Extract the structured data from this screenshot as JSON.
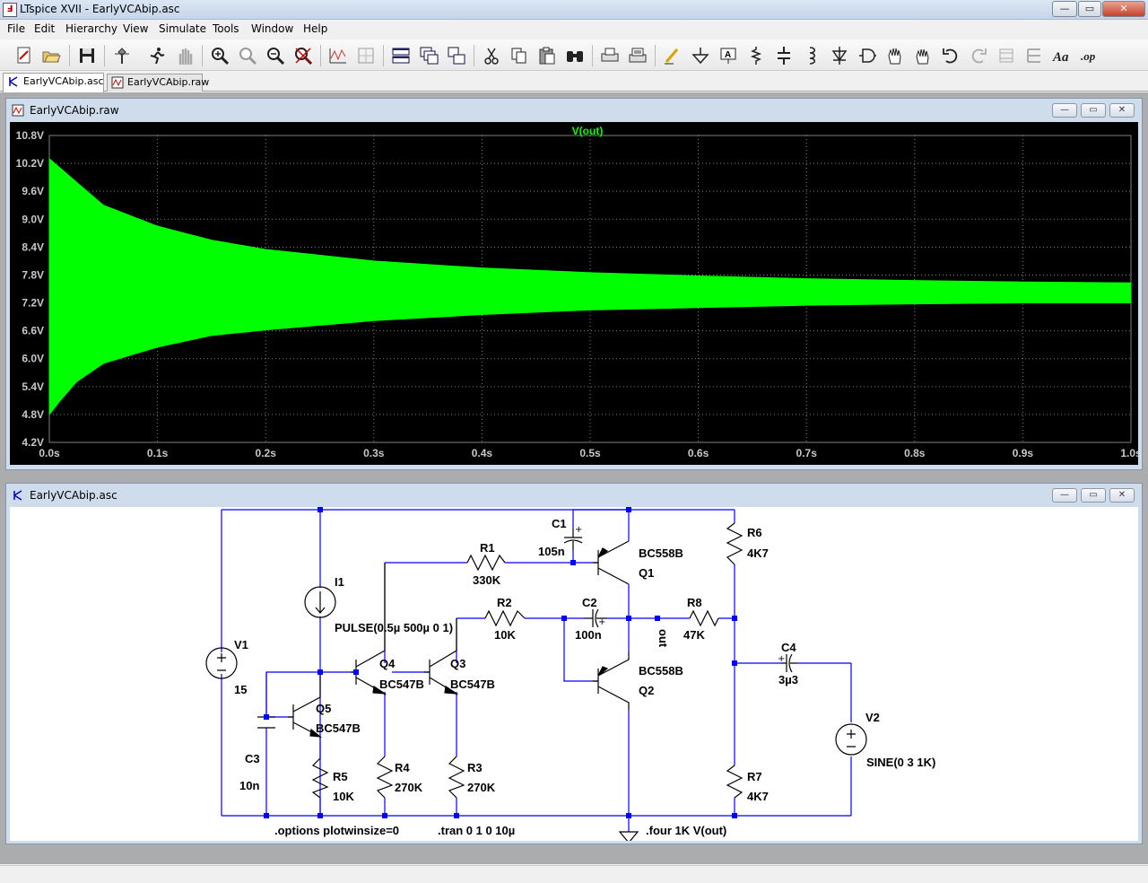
{
  "window": {
    "title": "LTspice XVII - EarlyVCAbip.asc",
    "app_icon": "ltspice-logo-icon",
    "controls": {
      "minimize": "—",
      "maximize": "▭",
      "close": "✕"
    }
  },
  "menu": {
    "items": [
      "File",
      "Edit",
      "Hierarchy",
      "View",
      "Simulate",
      "Tools",
      "Window",
      "Help"
    ]
  },
  "toolbar": {
    "buttons": [
      "new-schematic-icon",
      "open-icon",
      "save-icon",
      "control-panel-icon",
      "run-icon",
      "halt-icon",
      "zoom-in-icon",
      "zoom-fit-icon",
      "zoom-out-icon",
      "zoom-cancel-icon",
      "autorange-icon",
      "waveform-grid-icon",
      "tile-horizontal-icon",
      "cascade-icon",
      "tile-vertical-icon",
      "cut-icon",
      "copy-icon",
      "paste-icon",
      "find-icon",
      "print-icon",
      "print-setup-icon",
      "wire-icon",
      "ground-icon",
      "label-icon",
      "resistor-icon",
      "capacitor-icon",
      "inductor-icon",
      "diode-icon",
      "component-icon",
      "move-icon",
      "drag-icon",
      "undo-icon",
      "redo-icon",
      "rotate-icon",
      "mirror-icon",
      "text-icon",
      "spice-directive-icon"
    ]
  },
  "tabs": [
    {
      "label": "EarlyVCAbip.asc",
      "icon": "schematic-icon",
      "active": true
    },
    {
      "label": "EarlyVCAbip.raw",
      "icon": "waveform-icon",
      "active": false
    }
  ],
  "plot_window": {
    "title": "EarlyVCAbip.raw",
    "icon": "waveform-icon",
    "trace_color": "#00ff00",
    "background": "#000000",
    "chart_data": {
      "type": "area",
      "title": "V(out)",
      "xlabel": "",
      "ylabel": "",
      "x_ticks": [
        "0.0s",
        "0.1s",
        "0.2s",
        "0.3s",
        "0.4s",
        "0.5s",
        "0.6s",
        "0.7s",
        "0.8s",
        "0.9s",
        "1.0s"
      ],
      "y_ticks": [
        "10.8V",
        "10.2V",
        "9.6V",
        "9.0V",
        "8.4V",
        "7.8V",
        "7.2V",
        "6.6V",
        "6.0V",
        "5.4V",
        "4.8V",
        "4.2V"
      ],
      "xlim": [
        0,
        1.0
      ],
      "ylim": [
        4.2,
        10.8
      ],
      "grid": true,
      "series": [
        {
          "name": "V(out)",
          "x": [
            0.0,
            0.01,
            0.025,
            0.05,
            0.1,
            0.15,
            0.2,
            0.3,
            0.4,
            0.5,
            0.6,
            0.7,
            0.8,
            0.9,
            1.0
          ],
          "upper": [
            10.3,
            10.1,
            9.8,
            9.3,
            8.85,
            8.55,
            8.35,
            8.1,
            7.95,
            7.85,
            7.78,
            7.72,
            7.68,
            7.65,
            7.63
          ],
          "lower": [
            4.8,
            5.1,
            5.5,
            5.9,
            6.25,
            6.5,
            6.62,
            6.82,
            6.95,
            7.05,
            7.1,
            7.15,
            7.18,
            7.2,
            7.2
          ]
        }
      ]
    }
  },
  "schematic_window": {
    "title": "EarlyVCAbip.asc",
    "icon": "schematic-icon",
    "labels": {
      "v1": "V1",
      "v1_val": "15",
      "i1": "I1",
      "i1_val": "PULSE(0.5µ 500µ 0 1)",
      "q1": "Q1",
      "q1_model": "BC558B",
      "q2": "Q2",
      "q2_model": "BC558B",
      "q3": "Q3",
      "q3_model": "BC547B",
      "q4": "Q4",
      "q4_model": "BC547B",
      "q5": "Q5",
      "q5_model": "BC547B",
      "r1": "R1",
      "r1_val": "330K",
      "r2": "R2",
      "r2_val": "10K",
      "r3": "R3",
      "r3_val": "270K",
      "r4": "R4",
      "r4_val": "270K",
      "r5": "R5",
      "r5_val": "10K",
      "r6": "R6",
      "r6_val": "4K7",
      "r7": "R7",
      "r7_val": "4K7",
      "r8": "R8",
      "r8_val": "47K",
      "c1": "C1",
      "c1_val": "105n",
      "c2": "C2",
      "c2_val": "100n",
      "c3": "C3",
      "c3_val": "10n",
      "c4": "C4",
      "c4_val": "3µ3",
      "v2": "V2",
      "v2_val": "SINE(0 3 1K)",
      "net_out": "out",
      "dir_options": ".options plotwinsize=0",
      "dir_tran": ".tran 0 1 0 10µ",
      "dir_four": ".four 1K V(out)"
    }
  }
}
